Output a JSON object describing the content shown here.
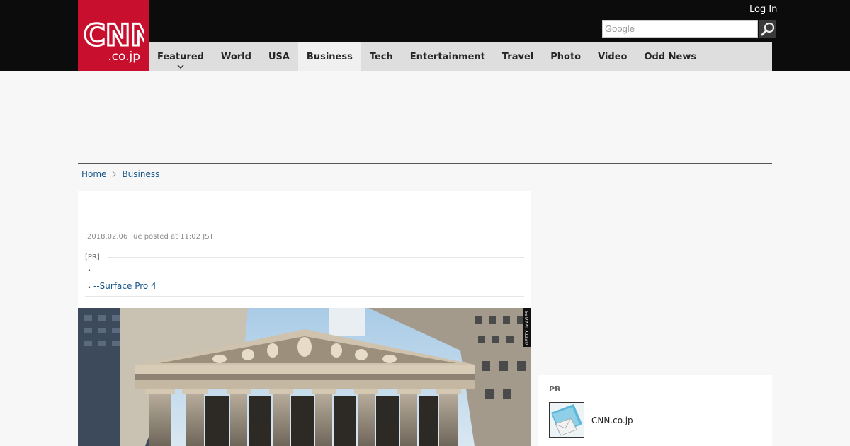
{
  "header": {
    "logo_text": "CNN",
    "logo_sub": ".co.jp",
    "login_label": "Log In",
    "search": {
      "placeholder": "Google",
      "value": ""
    },
    "colors": {
      "brand": "#c8102e",
      "bar": "#0c0c0c",
      "nav": "#dedede"
    }
  },
  "nav": {
    "items": [
      {
        "label": "Featured",
        "has_dropdown": true
      },
      {
        "label": "World"
      },
      {
        "label": "USA"
      },
      {
        "label": "Business",
        "active": true
      },
      {
        "label": "Tech"
      },
      {
        "label": "Entertainment"
      },
      {
        "label": "Travel"
      },
      {
        "label": "Photo"
      },
      {
        "label": "Video"
      },
      {
        "label": "Odd News"
      }
    ]
  },
  "breadcrumb": {
    "home": "Home",
    "current": "Business"
  },
  "article": {
    "date": "2018.02.06 Tue posted at 11:02 JST",
    "pr_label": "[PR]",
    "bullet": "・",
    "pr_link": "--Surface Pro 4",
    "photo_credit": "GETTY IMAGES"
  },
  "sidebar": {
    "pr_title": "PR",
    "pr_item": "CNN.co.jp"
  }
}
